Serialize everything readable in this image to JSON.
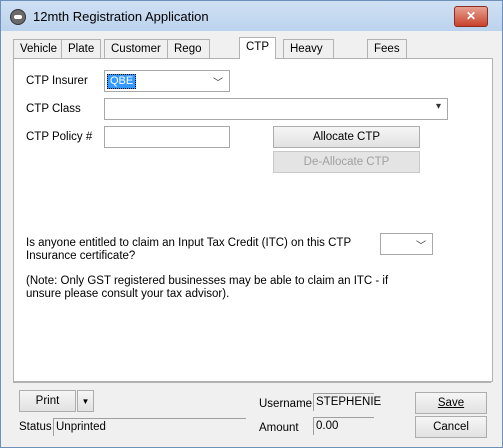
{
  "window": {
    "title": "12mth Registration Application",
    "close_glyph": "✕"
  },
  "tabs": [
    {
      "label": "Vehicle"
    },
    {
      "label": "Plate"
    },
    {
      "label": "Customer"
    },
    {
      "label": "Rego Detail"
    },
    {
      "label": "CTP"
    },
    {
      "label": "Heavy Vehicle"
    },
    {
      "label": "Fees"
    }
  ],
  "active_tab": "CTP",
  "ctp": {
    "insurer_label": "CTP Insurer",
    "insurer_value": "QBE",
    "class_label": "CTP Class",
    "class_value": "",
    "policy_label": "CTP Policy #",
    "policy_value": "",
    "allocate_label": "Allocate CTP",
    "deallocate_label": "De-Allocate CTP",
    "itc_question": "Is anyone entitled to claim an Input Tax Credit (ITC) on this CTP Insurance certificate?",
    "itc_value": "",
    "itc_note": "(Note: Only GST registered businesses may be able to claim an ITC - if unsure please consult your tax advisor)."
  },
  "footer": {
    "print_label": "Print",
    "status_label": "Status",
    "status_value": "Unprinted",
    "username_label": "Username",
    "username_value": "STEPHENIE",
    "amount_label": "Amount",
    "amount_value": "0.00",
    "save_label": "Save",
    "cancel_label": "Cancel"
  },
  "icons": {
    "dropdown": "chevron-down-icon",
    "close": "close-icon",
    "app": "app-icon"
  },
  "colors": {
    "selection": "#3399ff",
    "close_button": "#c8432c",
    "titlebar": "#bcd3ee"
  }
}
